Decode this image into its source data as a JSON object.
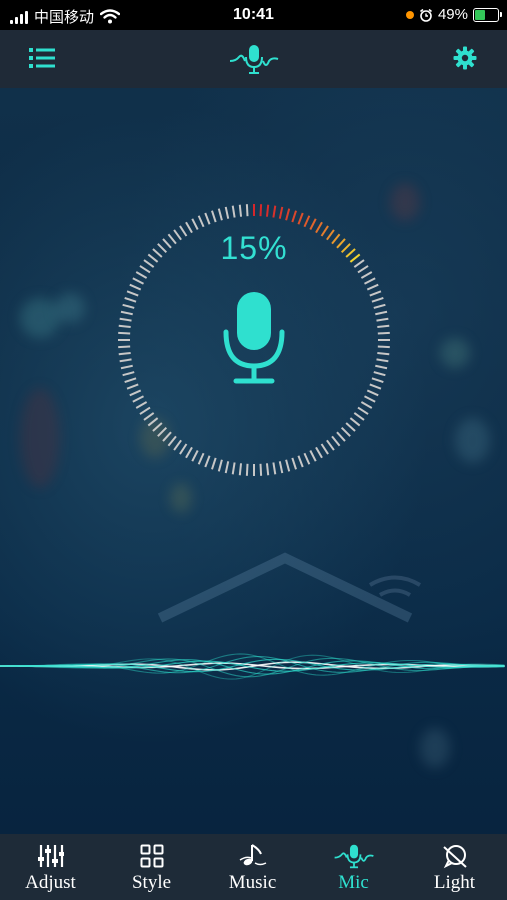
{
  "status_bar": {
    "carrier": "中国移动",
    "time": "10:41",
    "battery_percent": "49%",
    "battery_level": 0.49
  },
  "nav": {
    "menu_icon": "list-icon",
    "center_icon": "mic-wave-icon",
    "settings_icon": "gear-icon"
  },
  "mic_meter": {
    "level_text": "15%",
    "level": 0.15,
    "colors": {
      "track": "#c7c7c7",
      "low": "#d6262b",
      "high": "#f2d52e",
      "accent": "#2fe0cf"
    }
  },
  "tabs": [
    {
      "label": "Adjust",
      "icon": "sliders-icon",
      "active": false
    },
    {
      "label": "Style",
      "icon": "grid-icon",
      "active": false
    },
    {
      "label": "Music",
      "icon": "music-note-icon",
      "active": false
    },
    {
      "label": "Mic",
      "icon": "mic-wave-icon",
      "active": true
    },
    {
      "label": "Light",
      "icon": "light-icon",
      "active": false
    }
  ]
}
